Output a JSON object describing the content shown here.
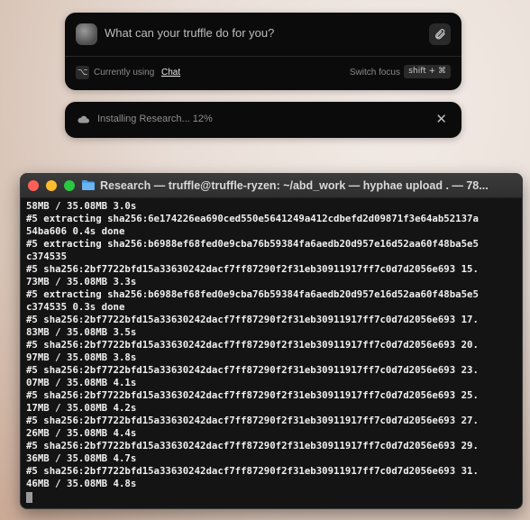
{
  "prompt": {
    "placeholder": "What can your truffle do for you?",
    "option_key": "⌥",
    "currently_using": "Currently using",
    "mode": "Chat",
    "switch_focus": "Switch focus",
    "shortcut": "shift + ⌘"
  },
  "status": {
    "text": "Installing Research... 12%",
    "progress_percent": 12
  },
  "terminal": {
    "title": "Research — truffle@truffle-ryzen: ~/abd_work — hyphae upload . — 78...",
    "lines": [
      "58MB / 35.08MB 3.0s",
      "#5 extracting sha256:6e174226ea690ced550e5641249a412cdbefd2d09871f3e64ab52137a",
      "54ba606 0.4s done",
      "#5 extracting sha256:b6988ef68fed0e9cba76b59384fa6aedb20d957e16d52aa60f48ba5e5",
      "c374535",
      "#5 sha256:2bf7722bfd15a33630242dacf7ff87290f2f31eb30911917ff7c0d7d2056e693 15.",
      "73MB / 35.08MB 3.3s",
      "#5 extracting sha256:b6988ef68fed0e9cba76b59384fa6aedb20d957e16d52aa60f48ba5e5",
      "c374535 0.3s done",
      "#5 sha256:2bf7722bfd15a33630242dacf7ff87290f2f31eb30911917ff7c0d7d2056e693 17.",
      "83MB / 35.08MB 3.5s",
      "#5 sha256:2bf7722bfd15a33630242dacf7ff87290f2f31eb30911917ff7c0d7d2056e693 20.",
      "97MB / 35.08MB 3.8s",
      "#5 sha256:2bf7722bfd15a33630242dacf7ff87290f2f31eb30911917ff7c0d7d2056e693 23.",
      "07MB / 35.08MB 4.1s",
      "#5 sha256:2bf7722bfd15a33630242dacf7ff87290f2f31eb30911917ff7c0d7d2056e693 25.",
      "17MB / 35.08MB 4.2s",
      "#5 sha256:2bf7722bfd15a33630242dacf7ff87290f2f31eb30911917ff7c0d7d2056e693 27.",
      "26MB / 35.08MB 4.4s",
      "#5 sha256:2bf7722bfd15a33630242dacf7ff87290f2f31eb30911917ff7c0d7d2056e693 29.",
      "36MB / 35.08MB 4.7s",
      "#5 sha256:2bf7722bfd15a33630242dacf7ff87290f2f31eb30911917ff7c0d7d2056e693 31.",
      "46MB / 35.08MB 4.8s"
    ]
  },
  "colors": {
    "close": "#ff5f57",
    "minimize": "#febc2e",
    "zoom": "#28c840",
    "folder": "#4a9ee8"
  },
  "icons": [
    "orb-icon",
    "paperclip-icon",
    "option-key-icon",
    "cloud-icon",
    "close-icon",
    "folder-icon"
  ]
}
